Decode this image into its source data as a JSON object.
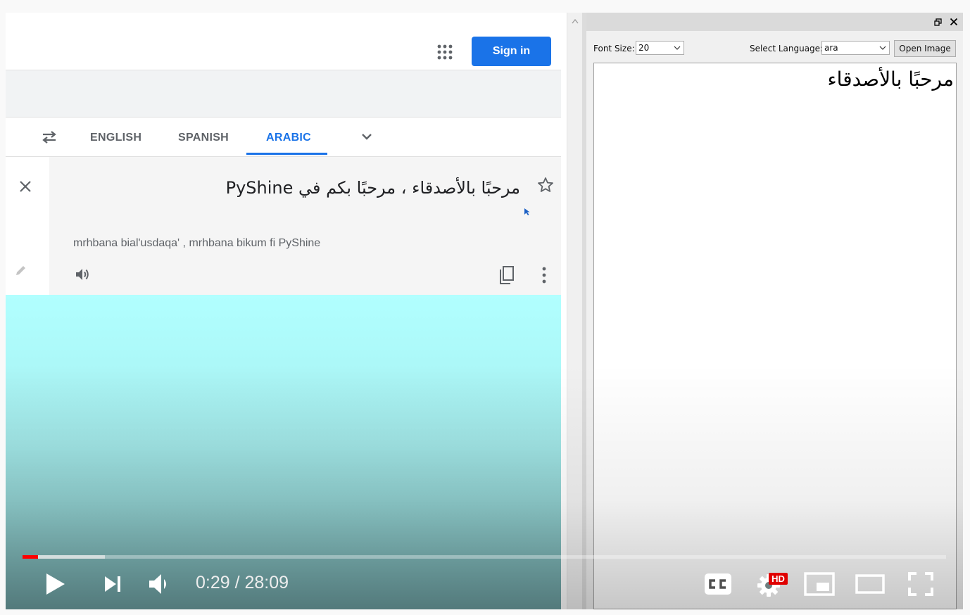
{
  "browser": {
    "signin_label": "Sign in",
    "languages": [
      "ENGLISH",
      "SPANISH",
      "ARABIC"
    ],
    "active_language": "ARABIC",
    "translation_text": "مرحبًا بالأصدقاء ، مرحبًا بكم في PyShine",
    "transliteration": "mrhbana bial'usdaqa' , mrhbana bikum fi PyShine",
    "accent_color": "#1a73e8"
  },
  "app": {
    "font_size_label": "Font Size:",
    "font_size_value": "20",
    "language_label": "Select Language:",
    "language_value": "ara",
    "open_image_label": "Open Image",
    "ocr_text": "مرحبًا بالأصدقاء"
  },
  "player": {
    "time_display": "0:29 / 28:09",
    "played_fraction": 0.017,
    "buffered_fraction": 0.089,
    "hd_badge": "HD",
    "progress_color": "#ff0000",
    "icons": [
      "play-icon",
      "next-icon",
      "volume-icon",
      "captions-icon",
      "settings-icon",
      "miniplayer-icon",
      "theater-icon",
      "fullscreen-icon"
    ]
  }
}
